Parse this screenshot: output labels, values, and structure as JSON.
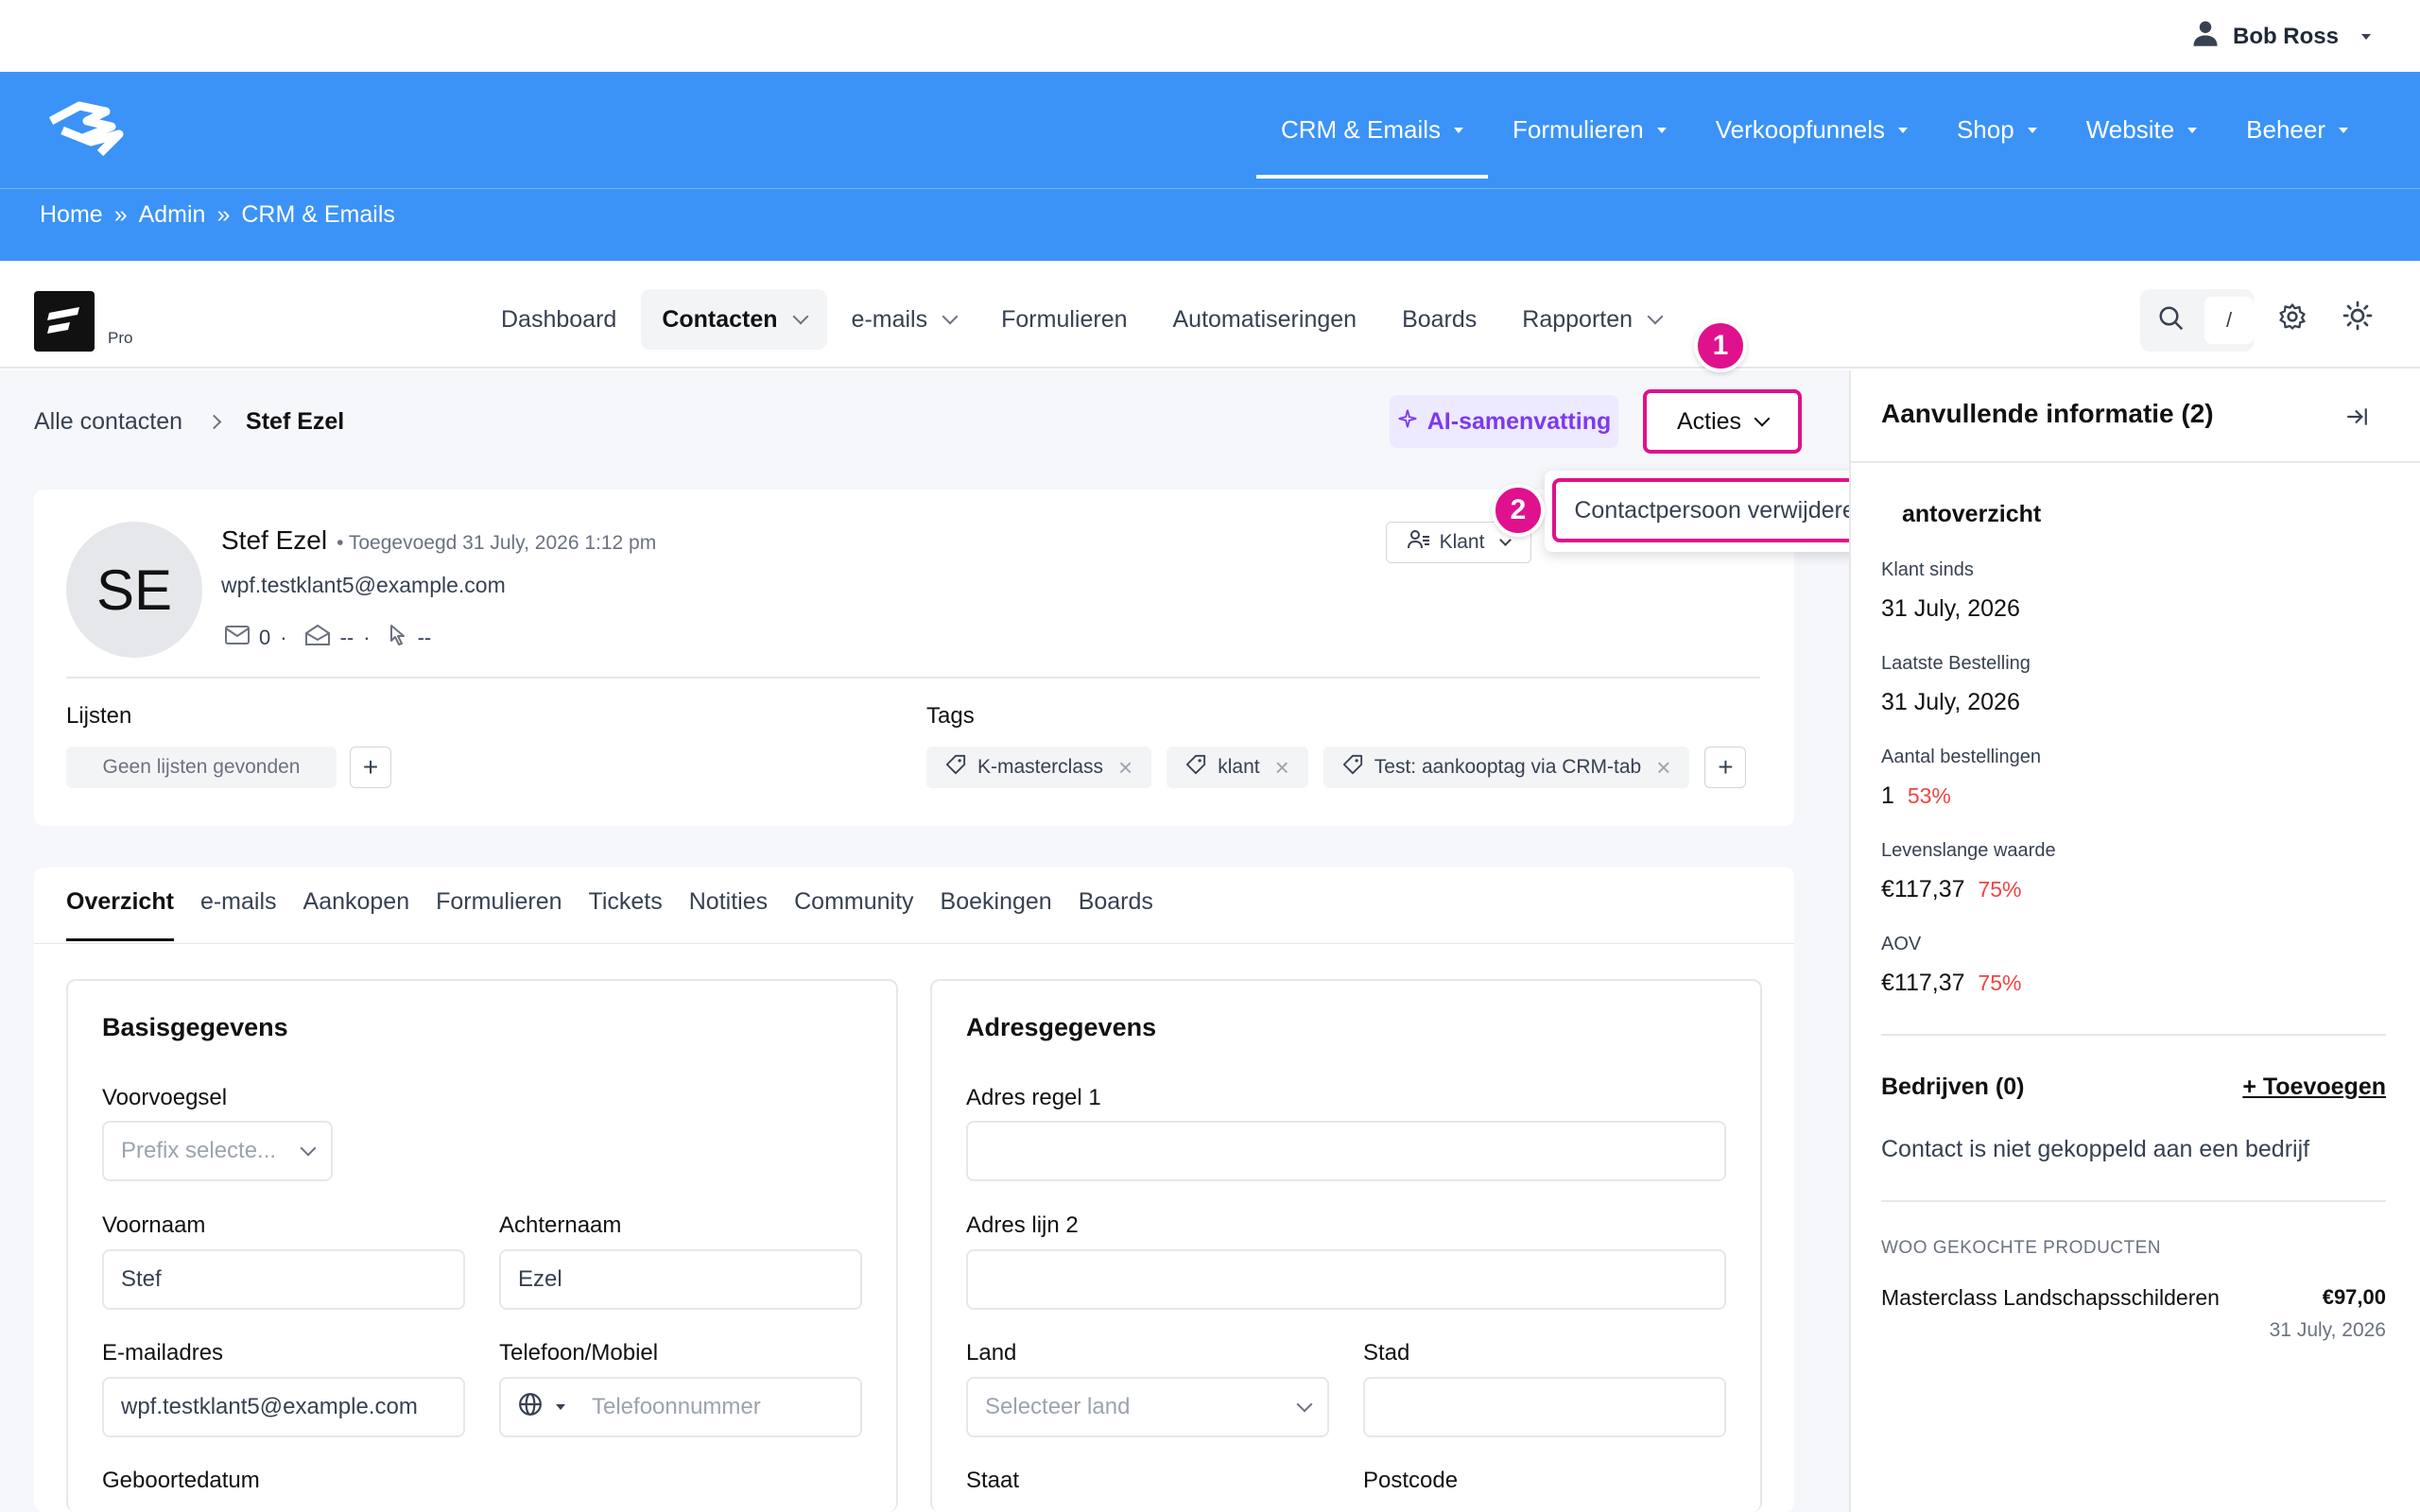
{
  "user": {
    "name": "Bob Ross"
  },
  "mainnav": [
    {
      "label": "CRM & Emails",
      "active": true
    },
    {
      "label": "Formulieren"
    },
    {
      "label": "Verkoopfunnels"
    },
    {
      "label": "Shop"
    },
    {
      "label": "Website"
    },
    {
      "label": "Beheer"
    }
  ],
  "breadcrumb": [
    "Home",
    "Admin",
    "CRM & Emails"
  ],
  "breadcrumb_sep": "»",
  "app": {
    "badge": "Pro",
    "search_shortcut": "/",
    "nav": [
      {
        "label": "Dashboard"
      },
      {
        "label": "Contacten",
        "active": true
      },
      {
        "label": "e-mails"
      },
      {
        "label": "Formulieren"
      },
      {
        "label": "Automatiseringen"
      },
      {
        "label": "Boards"
      },
      {
        "label": "Rapporten"
      }
    ]
  },
  "page": {
    "crumb_root": "Alle contacten",
    "crumb_current": "Stef Ezel",
    "ai_label": "AI-samenvatting",
    "acties_label": "Acties",
    "delete_label": "Contactpersoon verwijderen",
    "step1": "1",
    "step2": "2"
  },
  "contact": {
    "initials": "SE",
    "name": "Stef Ezel",
    "added": "Toegevoegd 31 July, 2026 1:12 pm",
    "email": "wpf.testklant5@example.com",
    "sent": "0",
    "opened": "--",
    "clicked": "--",
    "status": "Klant"
  },
  "lists": {
    "label": "Lijsten",
    "empty": "Geen lijsten gevonden"
  },
  "tags": {
    "label": "Tags",
    "items": [
      "K-masterclass",
      "klant",
      "Test: aankooptag via CRM-tab"
    ]
  },
  "tabs": [
    "Overzicht",
    "e-mails",
    "Aankopen",
    "Formulieren",
    "Tickets",
    "Notities",
    "Community",
    "Boekingen",
    "Boards"
  ],
  "basic": {
    "title": "Basisgegevens",
    "prefix_label": "Voorvoegsel",
    "prefix_placeholder": "Prefix selecte...",
    "first_label": "Voornaam",
    "first_value": "Stef",
    "last_label": "Achternaam",
    "last_value": "Ezel",
    "email_label": "E-mailadres",
    "email_value": "wpf.testklant5@example.com",
    "phone_label": "Telefoon/Mobiel",
    "phone_placeholder": "Telefoonnummer",
    "dob_label": "Geboortedatum"
  },
  "address": {
    "title": "Adresgegevens",
    "line1_label": "Adres regel 1",
    "line2_label": "Adres lijn 2",
    "country_label": "Land",
    "country_placeholder": "Selecteer land",
    "city_label": "Stad",
    "state_label": "Staat",
    "zip_label": "Postcode"
  },
  "side": {
    "title": "Aanvullende informatie (2)",
    "section_title": "antoverzicht",
    "customer_since_label": "Klant sinds",
    "customer_since": "31 July, 2026",
    "last_order_label": "Laatste Bestelling",
    "last_order": "31 July, 2026",
    "orders_label": "Aantal bestellingen",
    "orders": "1",
    "orders_pct": "53%",
    "ltv_label": "Levenslange waarde",
    "ltv": "€117,37",
    "ltv_pct": "75%",
    "aov_label": "AOV",
    "aov": "€117,37",
    "aov_pct": "75%",
    "companies_title": "Bedrijven (0)",
    "companies_add": "+ Toevoegen",
    "companies_empty": "Contact is niet gekoppeld aan een bedrijf",
    "products_title": "WOO GEKOCHTE PRODUCTEN",
    "product_name": "Masterclass Landschapsschilderen",
    "product_price": "€97,00",
    "product_date": "31 July, 2026"
  },
  "colors": {
    "brand": "#3b93f7",
    "highlight": "#e0118c",
    "ai": "#7c3aed",
    "negative": "#ef4444"
  }
}
